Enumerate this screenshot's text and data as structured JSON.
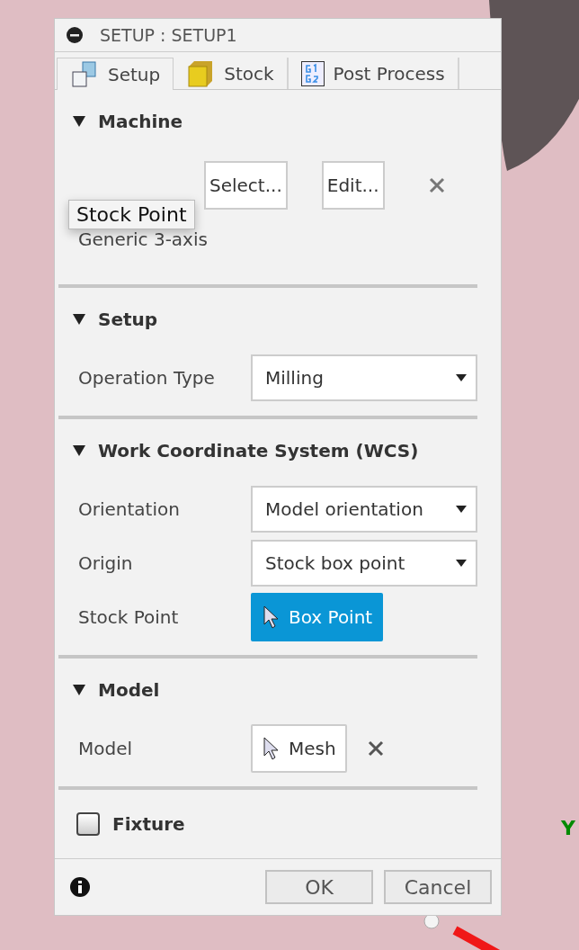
{
  "window": {
    "title": "SETUP : SETUP1"
  },
  "tabs": [
    {
      "label": "Setup",
      "kind": "setup",
      "selected": true
    },
    {
      "label": "Stock",
      "kind": "stock",
      "selected": false
    },
    {
      "label": "Post Process",
      "kind": "post",
      "selected": false
    }
  ],
  "sections": [
    {
      "title": "Machine",
      "expanded": true,
      "rows": [
        {
          "kind": "buttons",
          "buttons": [
            "Select...",
            "Edit..."
          ],
          "clearable": true
        },
        {
          "kind": "text",
          "text": "Generic 3-axis"
        }
      ]
    },
    {
      "title": "Setup",
      "expanded": true,
      "rows": [
        {
          "kind": "dropdown",
          "label": "Operation Type",
          "value": "Milling"
        }
      ]
    },
    {
      "title": "Work Coordinate System (WCS)",
      "expanded": true,
      "rows": [
        {
          "kind": "dropdown",
          "label": "Orientation",
          "value": "Model orientation"
        },
        {
          "kind": "dropdown",
          "label": "Origin",
          "value": "Stock box point"
        },
        {
          "kind": "picker",
          "label": "Stock Point",
          "value": "Box Point",
          "active": true,
          "clearable": false
        }
      ]
    },
    {
      "title": "Model",
      "expanded": true,
      "rows": [
        {
          "kind": "picker",
          "label": "Model",
          "value": "Mesh",
          "active": false,
          "clearable": true
        }
      ]
    }
  ],
  "fixture": {
    "label": "Fixture",
    "checked": false
  },
  "tooltip": {
    "text": "Stock Point"
  },
  "buttons": [
    "OK",
    "Cancel"
  ],
  "viewport": {
    "axis_label": "Y"
  }
}
